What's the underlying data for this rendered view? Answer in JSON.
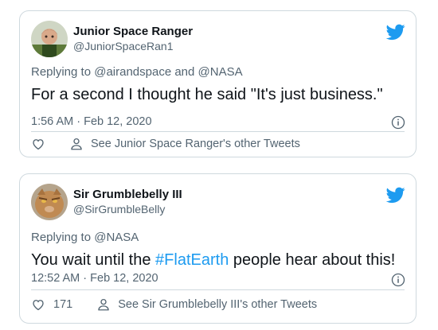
{
  "colors": {
    "accent": "#1d9bf0",
    "secondary_text": "#536471",
    "primary_text": "#0f1419",
    "border": "#cfd9de"
  },
  "tweets": [
    {
      "display_name": "Junior Space Ranger",
      "handle": "@JuniorSpaceRan1",
      "replying_prefix": "Replying to",
      "replying_to": [
        "@airandspace",
        "@NASA"
      ],
      "replying_joiner": "and",
      "text_before": "For a second I thought he said \"It's just business.\"",
      "hashtag": "",
      "text_after": "",
      "timestamp": "1:56 AM · Feb 12, 2020",
      "like_count": "",
      "profile_link": "See Junior Space Ranger's other Tweets",
      "icons": [
        "twitter-bird-icon",
        "info-icon",
        "heart-icon",
        "person-icon"
      ]
    },
    {
      "display_name": "Sir Grumblebelly III",
      "handle": "@SirGrumbleBelly",
      "replying_prefix": "Replying to",
      "replying_to": [
        "@NASA"
      ],
      "replying_joiner": "",
      "text_before": "You wait until the ",
      "hashtag": "#FlatEarth",
      "text_after": " people hear about this!",
      "timestamp": "12:52 AM · Feb 12, 2020",
      "like_count": "171",
      "profile_link": "See Sir Grumblebelly III's other Tweets",
      "icons": [
        "twitter-bird-icon",
        "info-icon",
        "heart-icon",
        "person-icon"
      ]
    }
  ]
}
